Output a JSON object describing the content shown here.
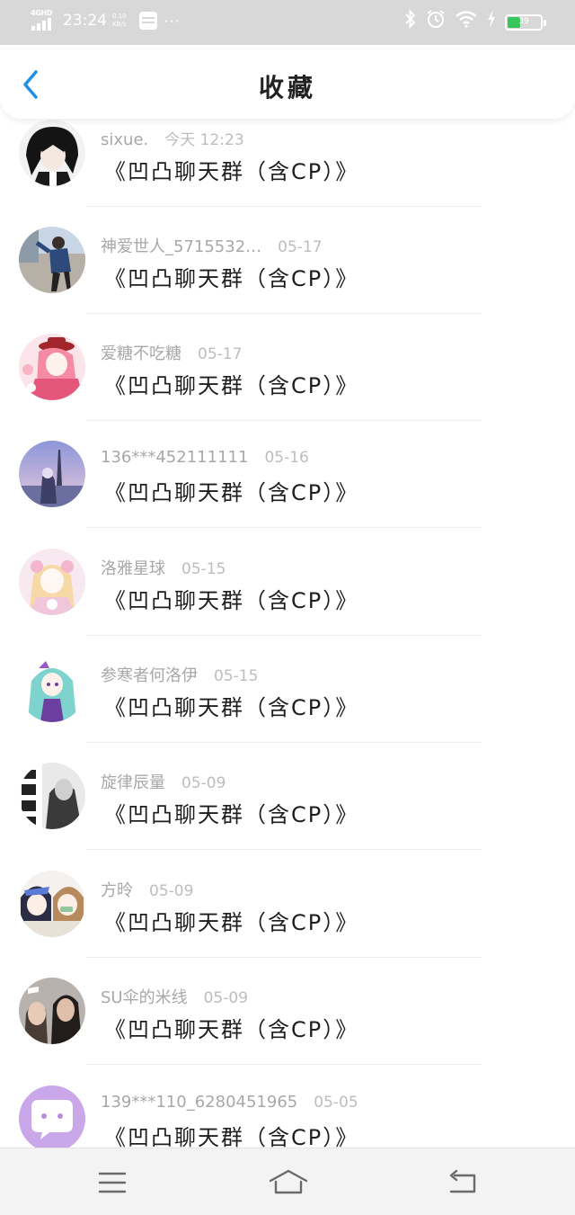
{
  "status_bar": {
    "network": "4GHD",
    "time": "23:24",
    "speed_value": "0.10",
    "speed_unit": "KB/s",
    "more": "···",
    "battery": "39",
    "battery_level": 0.39,
    "battery_color": "#35c759"
  },
  "header": {
    "back_icon": "chevron-left-icon",
    "title": "收藏",
    "accent_color": "#1e90e6"
  },
  "items": [
    {
      "sender": "sixue.",
      "date": "今天 12:23",
      "content": "《凹凸聊天群（含CP）》",
      "avatar": "gothic-anime-boy"
    },
    {
      "sender": "神爱世人_5715532…",
      "date": "05-17",
      "content": "《凹凸聊天群（含CP）》",
      "avatar": "street-photo"
    },
    {
      "sender": "爱糖不吃糖",
      "date": "05-17",
      "content": "《凹凸聊天群（含CP）》",
      "avatar": "pink-anime-girl"
    },
    {
      "sender": "136***452111111",
      "date": "05-16",
      "content": "《凹凸聊天群（含CP）》",
      "avatar": "purple-sky-scene"
    },
    {
      "sender": "洛雅星球",
      "date": "05-15",
      "content": "《凹凸聊天群（含CP）》",
      "avatar": "pastel-anime-girl"
    },
    {
      "sender": "参寒者何洛伊",
      "date": "05-15",
      "content": "《凹凸聊天群（含CP）》",
      "avatar": "teal-hair-anime-girl"
    },
    {
      "sender": "旋律辰量",
      "date": "05-09",
      "content": "《凹凸聊天群（含CP）》",
      "avatar": "monochrome-text-photo"
    },
    {
      "sender": "方昤",
      "date": "05-09",
      "content": "《凹凸聊天群（含CP）》",
      "avatar": "anime-duo"
    },
    {
      "sender": "SU伞的米线",
      "date": "05-09",
      "content": "《凹凸聊天群（含CP）》",
      "avatar": "two-people-photo"
    },
    {
      "sender": "139***110_6280451965",
      "date": "05-05",
      "content": "《凹凸聊天群（含CP）》",
      "avatar": "default-chat-avatar"
    }
  ],
  "nav_bar": {
    "menu_icon": "menu-icon",
    "home_icon": "home-icon",
    "back_icon": "return-icon"
  }
}
